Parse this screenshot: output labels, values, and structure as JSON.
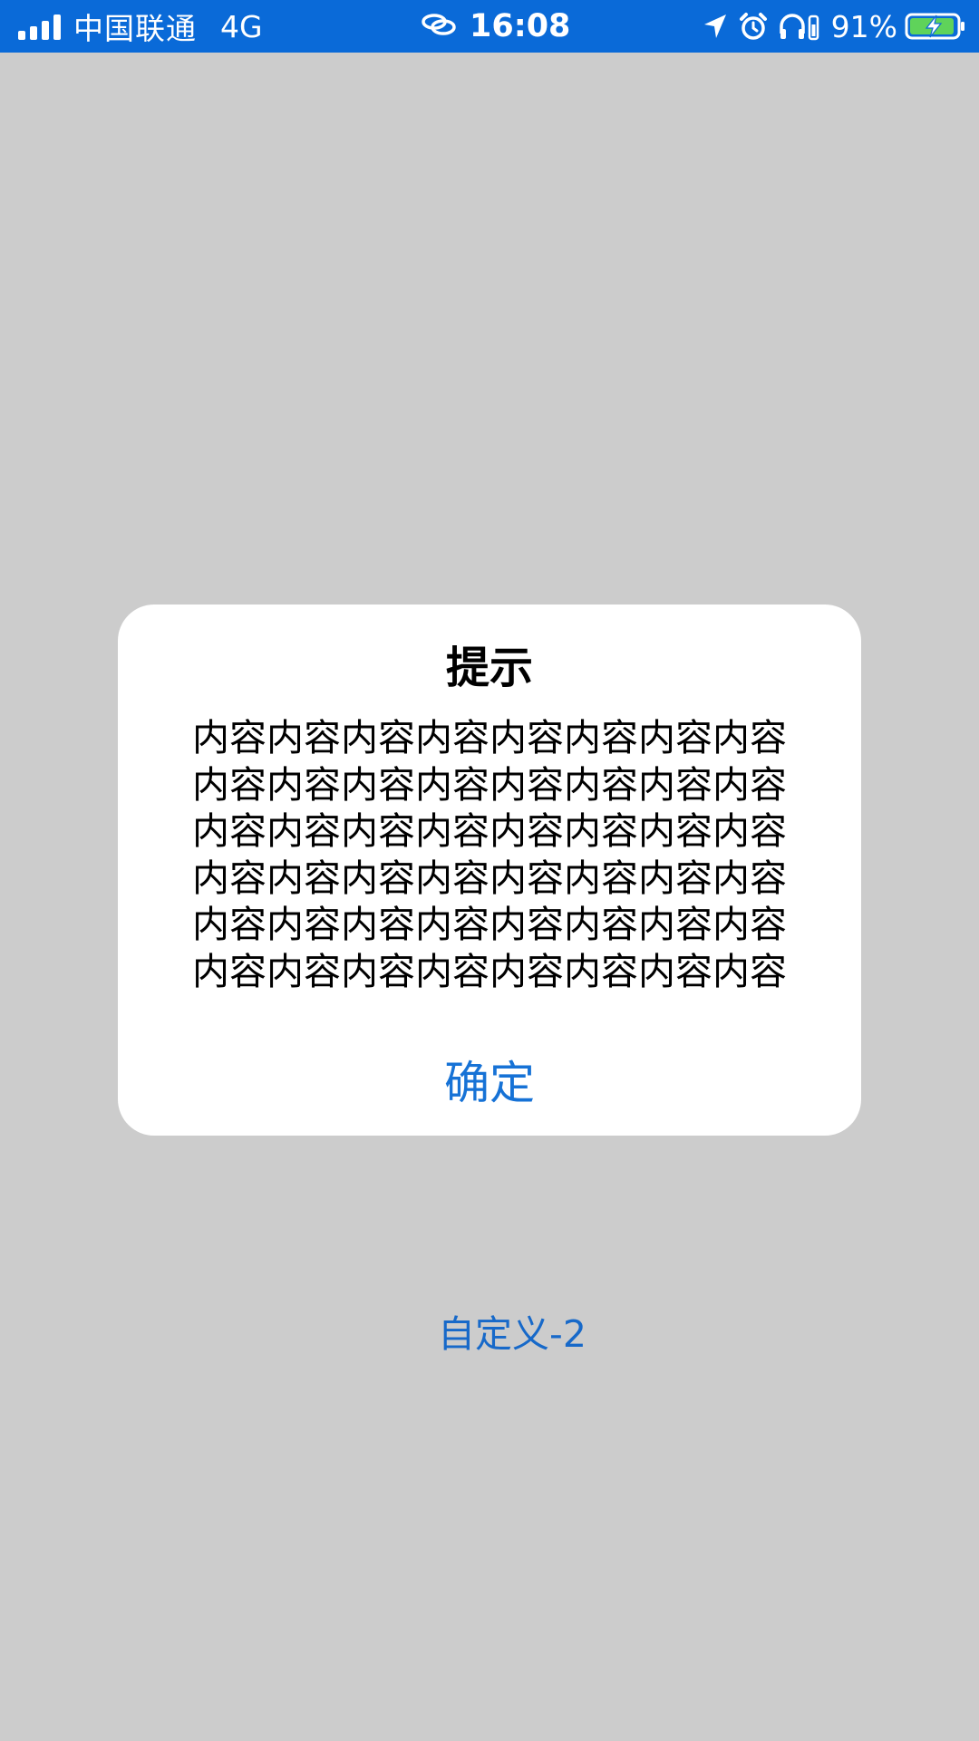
{
  "status_bar": {
    "carrier": "中国联通",
    "network": "4G",
    "time": "16:08",
    "battery_percent": "91%",
    "icons": [
      "signal-icon",
      "link-icon",
      "location-icon",
      "alarm-icon",
      "headphones-icon",
      "battery-charging-icon"
    ],
    "background_color": "#0a6ad8"
  },
  "dialog": {
    "title": "提示",
    "body_lines": [
      "内容内容内容内容内容内容内容内容",
      "内容内容内容内容内容内容内容内容",
      "内容内容内容内容内容内容内容内容",
      "内容内容内容内容内容内容内容内容",
      "内容内容内容内容内容内容内容内容",
      "内容内容内容内容内容内容内容内容"
    ],
    "confirm_label": "确定",
    "accent_color": "#1672d6"
  },
  "page": {
    "custom_link_label": "自定义-2",
    "background_color": "#cccccc"
  }
}
